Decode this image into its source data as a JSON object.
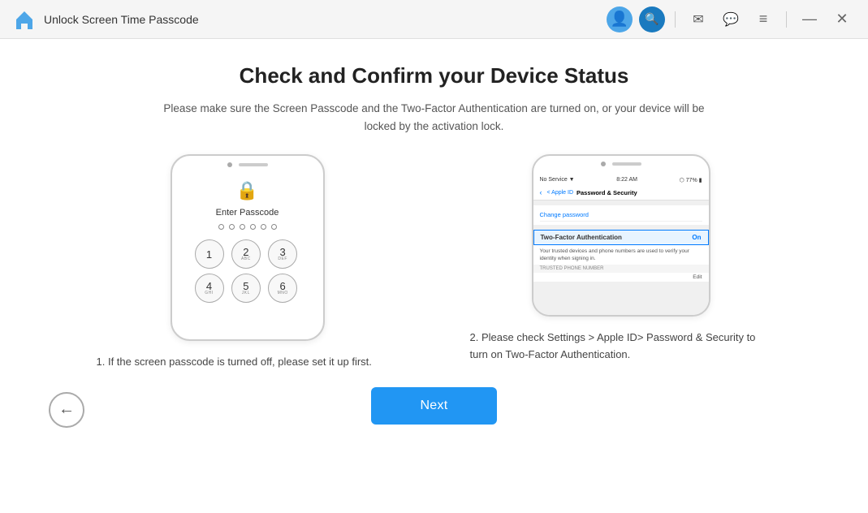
{
  "titleBar": {
    "title": "Unlock Screen Time Passcode",
    "icons": {
      "user": "👤",
      "search": "🔍",
      "mail": "✉",
      "chat": "💬",
      "menu": "≡",
      "minimize": "—",
      "close": "✕"
    }
  },
  "pageTitle": "Check and Confirm your Device Status",
  "pageSubtitle": "Please make sure the Screen Passcode and the Two-Factor Authentication are turned on, or your device will be locked by the activation lock.",
  "phone1": {
    "enterPasscode": "Enter Passcode",
    "keys": [
      {
        "num": "1",
        "sub": ""
      },
      {
        "num": "2",
        "sub": "ABC"
      },
      {
        "num": "3",
        "sub": "DEF"
      },
      {
        "num": "4",
        "sub": "GHI"
      },
      {
        "num": "5",
        "sub": "JKL"
      },
      {
        "num": "6",
        "sub": "MNO"
      }
    ]
  },
  "phone2": {
    "statusBar": {
      "left": "No Service ▼",
      "center": "8:22 AM",
      "right": "⬡ 77% ▮"
    },
    "navBack": "< Apple ID",
    "navTitle": "Password & Security",
    "changePassword": "Change password",
    "twoFactor": "Two-Factor Authentication",
    "twoFactorOn": "On",
    "description": "Your trusted devices and phone numbers are used to verify your identity when signing in.",
    "trustedLabel": "TRUSTED PHONE NUMBER",
    "editLabel": "Edit"
  },
  "description1": "1. If the screen passcode is turned off, please set it up first.",
  "description2": "2. Please check Settings > Apple ID> Password & Security to turn on Two-Factor Authentication.",
  "nextButton": "Next",
  "backButton": "←"
}
